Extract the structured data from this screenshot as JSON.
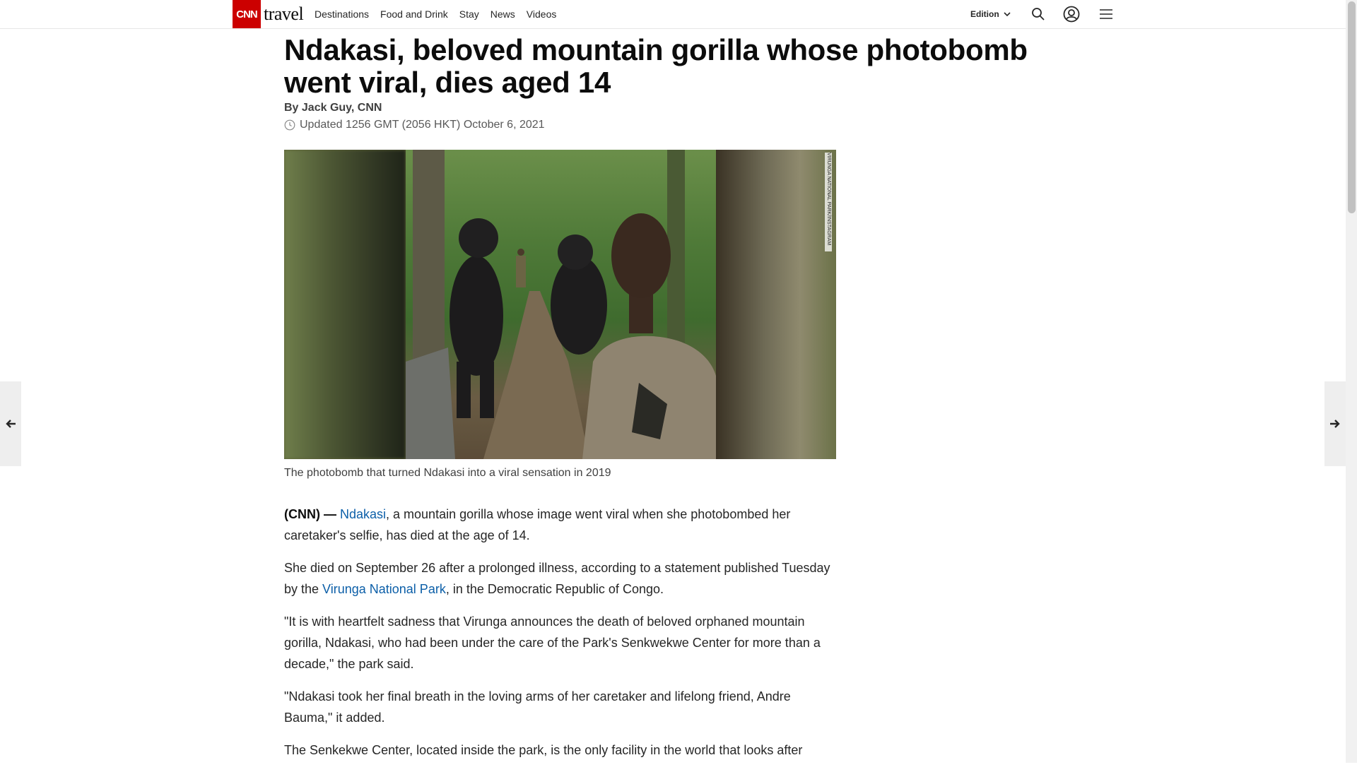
{
  "header": {
    "logo_text": "CNN",
    "section_text": "travel",
    "nav": [
      "Destinations",
      "Food and Drink",
      "Stay",
      "News",
      "Videos"
    ],
    "edition_label": "Edition",
    "icons": [
      "search-icon",
      "account-icon",
      "menu-icon"
    ]
  },
  "article": {
    "headline": "Ndakasi, beloved mountain gorilla whose photobomb went viral, dies aged 14",
    "byline": "By Jack Guy, CNN",
    "updated": "Updated 1256 GMT (2056 HKT) October 6, 2021",
    "image_credit": "VIRUNGA NATIONAL PARK/INSTAGRAM",
    "caption": "The photobomb that turned Ndakasi into a viral sensation in 2019",
    "paragraphs": [
      {
        "prefix": "(CNN) — ",
        "link": "Ndakasi",
        "text": ", a mountain gorilla whose image went viral when she photobombed her caretaker's selfie, has died at the age of 14."
      },
      {
        "pre": "She died on September 26 after a prolonged illness, according to a statement published Tuesday by the ",
        "link": "Virunga National Park",
        "post": ", in the Democratic Republic of Congo."
      },
      {
        "text": "\"It is with heartfelt sadness that Virunga announces the death of beloved orphaned mountain gorilla, Ndakasi, who had been under the care of the Park's Senkwekwe Center for more than a decade,\" the park said."
      },
      {
        "text": "\"Ndakasi took her final breath in the loving arms of her caretaker and lifelong friend, Andre Bauma,\" it added."
      },
      {
        "text": "The Senkekwe Center, located inside the park, is the only facility in the world that looks after"
      }
    ]
  },
  "colors": {
    "brand_red": "#cc0000",
    "link_blue": "#0c5fa8"
  }
}
